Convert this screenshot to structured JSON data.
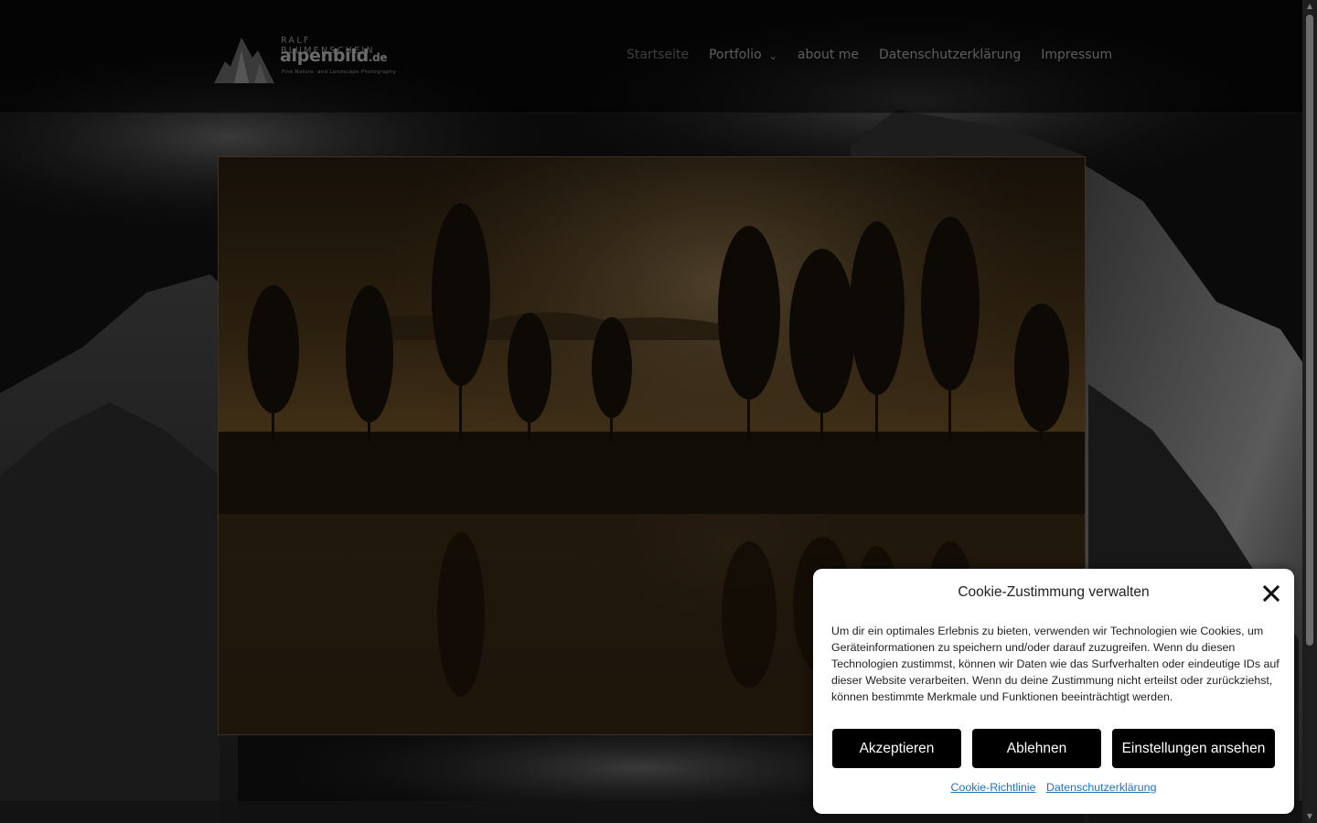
{
  "header": {
    "logo": {
      "owner": "RALF BLUMENSCHEIN",
      "brand": "alpenbild",
      "brand_suffix": ".de",
      "tagline": "Fine Nature- and Landscape Photography"
    },
    "nav": [
      {
        "label": "Startseite",
        "active": true
      },
      {
        "label": "Portfolio",
        "has_dropdown": true
      },
      {
        "label": "about me"
      },
      {
        "label": "Datenschutzerklärung"
      },
      {
        "label": "Impressum"
      }
    ]
  },
  "hero": {
    "subject": "misty lake with trees at sunrise"
  },
  "cookie_dialog": {
    "title": "Cookie-Zustimmung verwalten",
    "text": "Um dir ein optimales Erlebnis zu bieten, verwenden wir Technologien wie Cookies, um Geräteinformationen zu speichern und/oder darauf zuzugreifen. Wenn du diesen Technologien zustimmst, können wir Daten wie das Surfverhalten oder eindeutige IDs auf dieser Website verarbeiten. Wenn du deine Zustimmung nicht erteilst oder zurückziehst, können bestimmte Merkmale und Funktionen beeinträchtigt werden.",
    "accept_label": "Akzeptieren",
    "deny_label": "Ablehnen",
    "settings_label": "Einstellungen ansehen",
    "links": [
      "Cookie-Richtlinie",
      "Datenschutzerklärung"
    ]
  },
  "colors": {
    "dialog_bg": "#ffffff",
    "button_bg": "#000000",
    "link": "#1e73be",
    "nav_text": "#5e5e5e"
  }
}
